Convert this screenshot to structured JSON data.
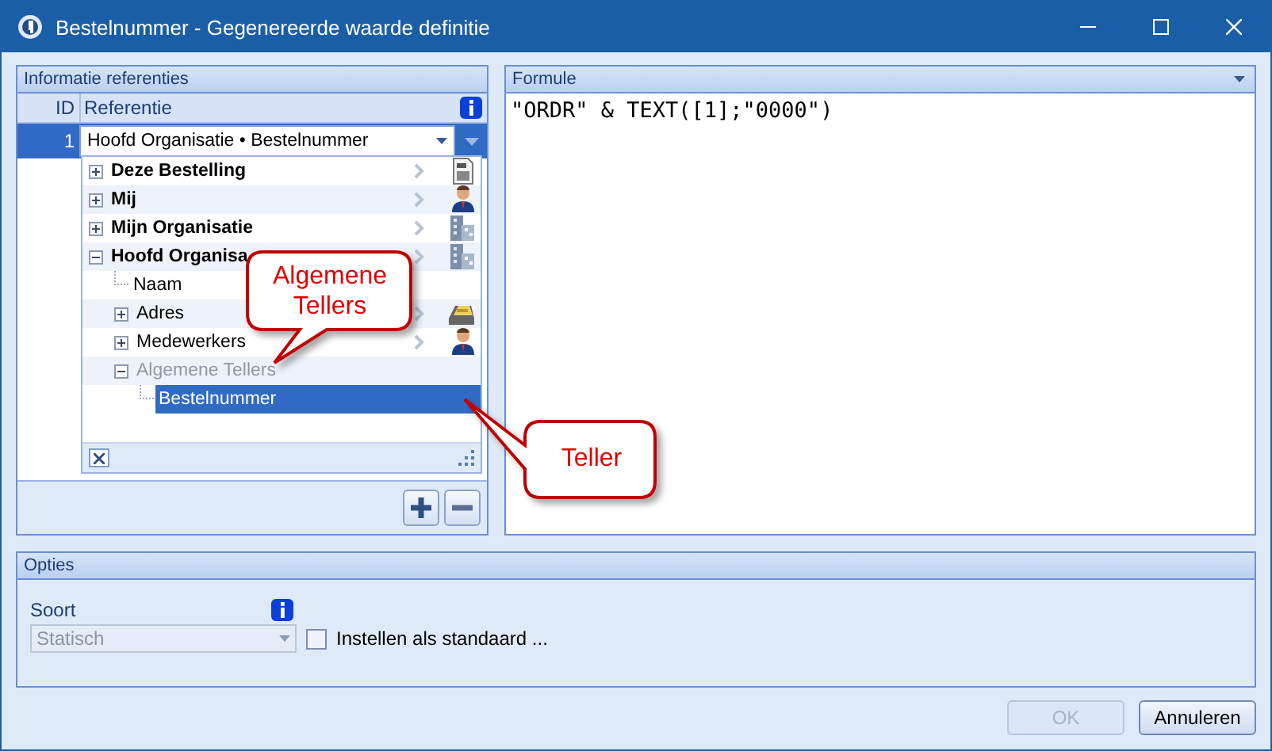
{
  "window": {
    "title": "Bestelnummer - Gegenereerde waarde definitie"
  },
  "references": {
    "title": "Informatie referenties",
    "columns": [
      "ID",
      "Referentie"
    ],
    "rows": [
      {
        "id": "1",
        "reference": "Hoofd Organisatie • Bestelnummer",
        "selected": true
      }
    ],
    "tree": [
      {
        "label": "Deze Bestelling",
        "kind": "order",
        "expanded": false,
        "selected": false
      },
      {
        "label": "Mij",
        "kind": "person",
        "expanded": false,
        "selected": false
      },
      {
        "label": "Mijn Organisatie",
        "kind": "organisation",
        "expanded": false,
        "selected": false
      },
      {
        "label": "Hoofd Organisa",
        "kind": "organisation",
        "expanded": true,
        "selected": false,
        "children": [
          {
            "label": "Naam",
            "selected": false
          },
          {
            "label": "Adres",
            "kind": "address",
            "expanded": false,
            "selected": false
          },
          {
            "label": "Medewerkers",
            "kind": "person",
            "expanded": false,
            "selected": false
          },
          {
            "label": "Algemene Tellers",
            "kind": "group",
            "expanded": true,
            "disabled": true,
            "selected": false,
            "children": [
              {
                "label": "Bestelnummer",
                "selected": true
              }
            ]
          }
        ]
      }
    ]
  },
  "formula": {
    "title": "Formule",
    "text": "\"ORDR\" & TEXT([1];\"0000\")"
  },
  "callouts": [
    {
      "text": "Algemene Tellers"
    },
    {
      "text": "Teller"
    }
  ],
  "options": {
    "title": "Opties",
    "type_label": "Soort",
    "type_value": "Statisch",
    "default_label": "Instellen als standaard ...",
    "default_checked": false
  },
  "buttons": [
    {
      "label": "OK",
      "disabled": true
    },
    {
      "label": "Annuleren",
      "disabled": false
    }
  ]
}
